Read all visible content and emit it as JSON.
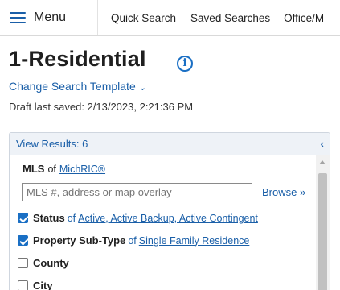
{
  "nav": {
    "menu_label": "Menu",
    "items": [
      "Quick Search",
      "Saved Searches",
      "Office/M"
    ]
  },
  "header": {
    "title": "1-Residential",
    "info_icon": "info-circle-icon",
    "change_template": "Change Search Template",
    "draft_saved": "Draft last saved: 2/13/2023, 2:21:36 PM"
  },
  "panel": {
    "view_results": "View Results: 6",
    "collapse_glyph": "‹",
    "mls": {
      "label": "MLS",
      "of": "of",
      "link": "MichRIC®",
      "placeholder": "MLS #, address or map overlay",
      "browse": "Browse »"
    },
    "fields": [
      {
        "label": "Status",
        "of": "of",
        "value": "Active, Active Backup, Active Contingent",
        "checked": true
      },
      {
        "label": "Property Sub-Type",
        "of": "of",
        "value": "Single Family Residence",
        "checked": true
      },
      {
        "label": "County",
        "of": "",
        "value": "",
        "checked": false
      },
      {
        "label": "City",
        "of": "",
        "value": "",
        "checked": false
      }
    ]
  },
  "colors": {
    "accent": "#1a5fa8",
    "checkbox_checked": "#1a6fc4",
    "panel_header_bg": "#eef2f7"
  }
}
